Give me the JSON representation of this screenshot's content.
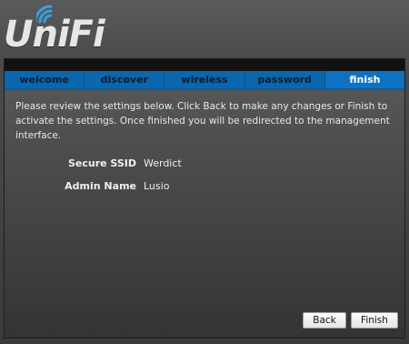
{
  "logo": {
    "text": "UniFi",
    "icon": "wifi-waves-icon"
  },
  "tabs": [
    {
      "label": "welcome",
      "active": false
    },
    {
      "label": "discover",
      "active": false
    },
    {
      "label": "wireless",
      "active": false
    },
    {
      "label": "password",
      "active": false
    },
    {
      "label": "finish",
      "active": true
    }
  ],
  "main": {
    "description": "Please review the settings below. Click Back to make any changes or Finish to activate the settings. Once finished you will be redirected to the management interface.",
    "settings": [
      {
        "label": "Secure SSID",
        "value": "Werdict"
      },
      {
        "label": "Admin Name",
        "value": "Lusio"
      }
    ]
  },
  "buttons": {
    "back": "Back",
    "finish": "Finish"
  },
  "colors": {
    "accent": "#0a67ad",
    "active_tab": "#0e72c2",
    "logo_waves": "#3a9fe0"
  }
}
